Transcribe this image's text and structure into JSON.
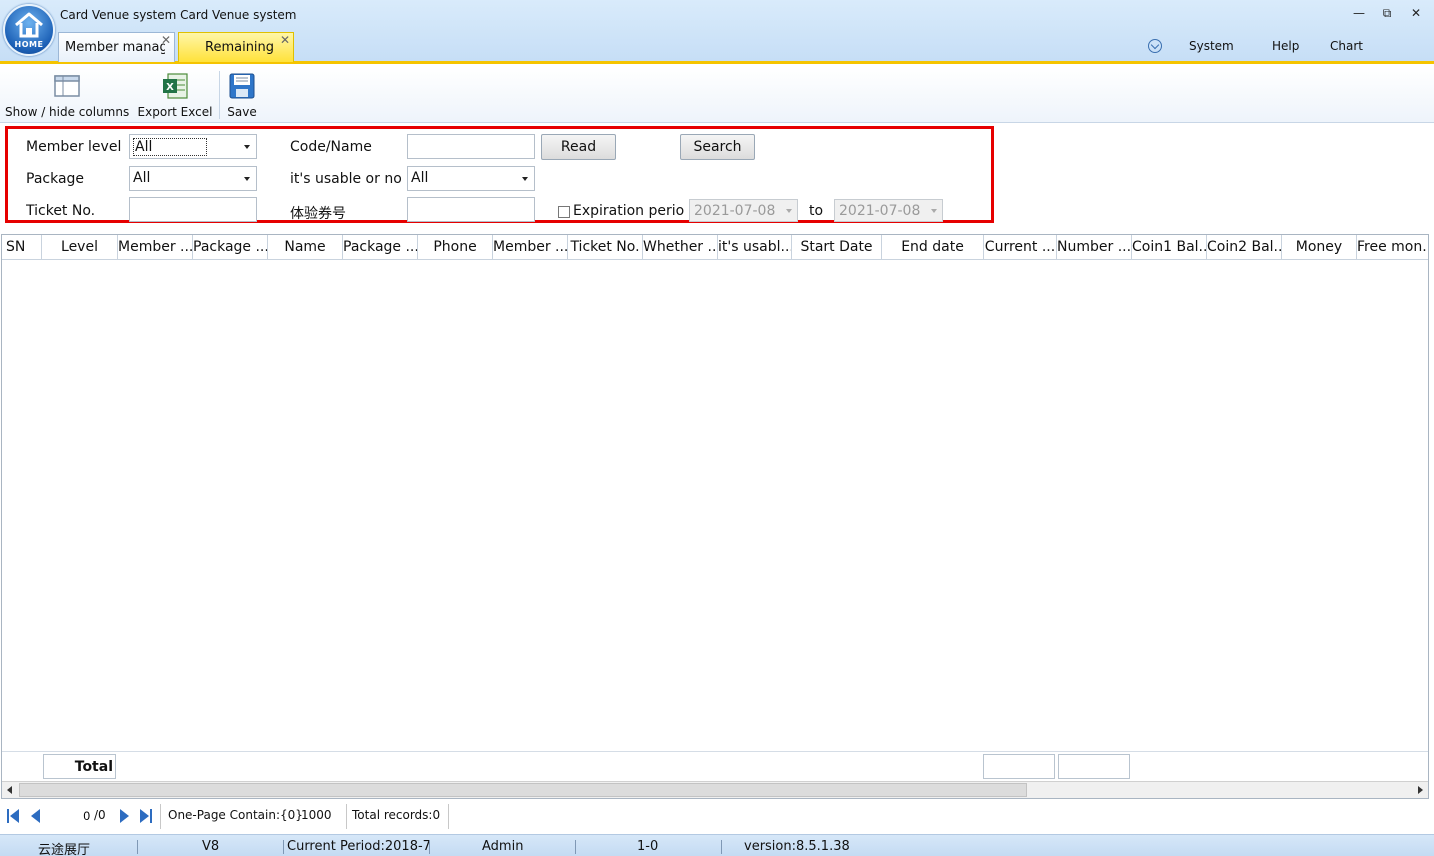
{
  "window": {
    "title": "Card Venue system Card Venue system",
    "home_label": "HOME",
    "controls": [
      "—",
      "⧉",
      "✕"
    ]
  },
  "tabs": [
    {
      "label": "Member management",
      "close": "✕"
    },
    {
      "label": "Remaining",
      "close": "✕"
    }
  ],
  "menu": {
    "system": "System",
    "help": "Help",
    "chart": "Chart"
  },
  "toolbar": {
    "show_hide_columns": "Show / hide columns",
    "export_excel": "Export Excel",
    "save": "Save"
  },
  "filter": {
    "member_level_label": "Member level",
    "member_level_value": "All",
    "code_name_label": "Code/Name",
    "code_name_value": "",
    "read_button": "Read",
    "search_button": "Search",
    "package_label": "Package",
    "package_value": "All",
    "usable_label": "it's usable or not",
    "usable_value": "All",
    "ticket_label": "Ticket No.",
    "ticket_value": "",
    "voucher_label": "体验券号",
    "voucher_value": "",
    "expiration_label": "Expiration period",
    "expiration_checked": false,
    "date_from": "2021-07-08",
    "to_label": "to",
    "date_to": "2021-07-08"
  },
  "grid": {
    "columns": [
      "SN",
      "Level",
      "Member ...",
      "Package ...",
      "Name",
      "Package ...",
      "Phone",
      "Member ...",
      "Ticket No.",
      "Whether ...",
      "it's usabl...",
      "Start Date",
      "End date",
      "Current ...",
      "Number ...",
      "Coin1 Bal...",
      "Coin2 Bal...",
      "Money",
      "Free mon..."
    ],
    "rows": [],
    "total_label": "Total"
  },
  "pager": {
    "current_page": "0",
    "total_pages": "/0",
    "one_page_label": "One-Page Contain:{0}",
    "page_size": "1000",
    "total_records": "Total records:0"
  },
  "status": {
    "venue": "云途展厅",
    "edition": "V8",
    "period": "Current Period:2018-7",
    "user": "Admin",
    "code": "1-0",
    "version": "version:8.5.1.38"
  },
  "colors": {
    "accent_tab": "#ffe23a",
    "highlight_border": "#e60000",
    "titlebar": "#c6def6"
  }
}
